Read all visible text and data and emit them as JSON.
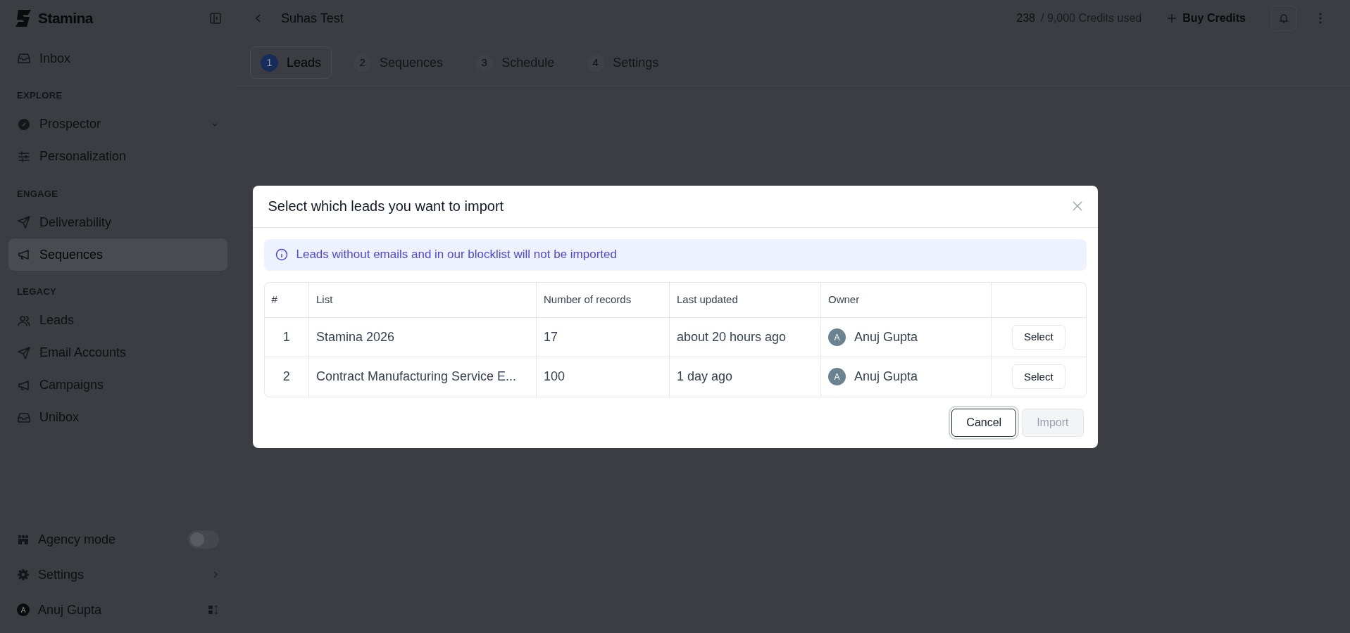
{
  "sidebar": {
    "brand": "Stamina",
    "groups": [
      {
        "items": [
          {
            "label": "Inbox",
            "selected": false
          }
        ]
      },
      {
        "heading": "EXPLORE",
        "items": [
          {
            "label": "Prospector",
            "selected": false,
            "expanded": false
          },
          {
            "label": "Personalization",
            "selected": false
          }
        ]
      },
      {
        "heading": "ENGAGE",
        "items": [
          {
            "label": "Deliverability",
            "selected": false
          },
          {
            "label": "Sequences",
            "selected": true
          }
        ]
      },
      {
        "heading": "LEGACY",
        "items": [
          {
            "label": "Leads",
            "selected": false
          },
          {
            "label": "Email Accounts",
            "selected": false
          },
          {
            "label": "Campaigns",
            "selected": false
          },
          {
            "label": "Unibox",
            "selected": false
          }
        ]
      }
    ],
    "agency_mode": {
      "label": "Agency mode",
      "on": false
    },
    "settings": {
      "label": "Settings"
    },
    "user": {
      "initial": "A",
      "name": "Anuj Gupta"
    }
  },
  "header": {
    "title": "Suhas Test",
    "credits_used": "238",
    "credits_total": "/ 9,000 Credits used",
    "buy_button": "Buy Credits"
  },
  "tabs": [
    {
      "number": "1",
      "label": "Leads",
      "selected": true
    },
    {
      "number": "2",
      "label": "Sequences",
      "selected": false
    },
    {
      "number": "3",
      "label": "Schedule",
      "selected": false
    },
    {
      "number": "4",
      "label": "Settings",
      "selected": false
    }
  ],
  "modal": {
    "title": "Select which leads you want to import",
    "notice": "Leads without emails and in our blocklist will not be imported",
    "table": {
      "columns": [
        "#",
        "List",
        "Number of records",
        "Last updated",
        "Owner"
      ],
      "rows": [
        {
          "index": "1",
          "list": "Stamina 2026",
          "records": "17",
          "updated": "about 20 hours ago",
          "owner_initial": "A",
          "owner": "Anuj Gupta",
          "action": "Select"
        },
        {
          "index": "2",
          "list": "Contract Manufacturing Service E...",
          "records": "100",
          "updated": "1 day ago",
          "owner_initial": "A",
          "owner": "Anuj Gupta",
          "action": "Select"
        }
      ]
    },
    "cancel": {
      "label": "Cancel",
      "focused": true
    },
    "import": {
      "label": "Import",
      "disabled": true
    }
  }
}
